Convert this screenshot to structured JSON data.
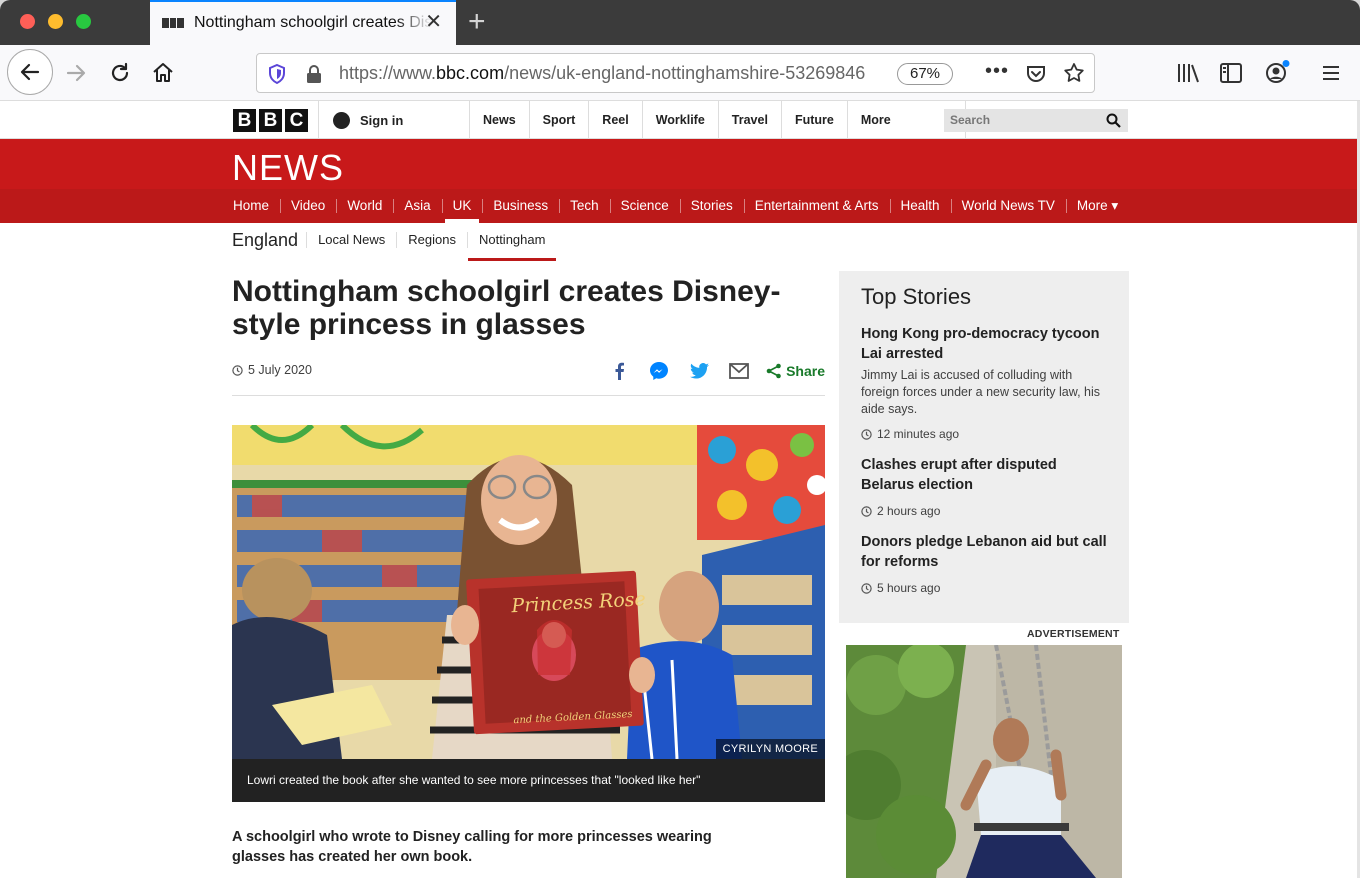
{
  "browser": {
    "tab_title": "Nottingham schoolgirl creates Disney-style princess in glasses",
    "url_prefix": "https://www.",
    "url_host": "bbc.com",
    "url_path": "/news/uk-england-nottinghamshire-53269846",
    "zoom": "67%"
  },
  "bbc": {
    "logo_letters": [
      "B",
      "B",
      "C"
    ],
    "signin": "Sign in",
    "topnav": [
      "News",
      "Sport",
      "Reel",
      "Worklife",
      "Travel",
      "Future",
      "More"
    ],
    "search_placeholder": "Search",
    "news_logo": "NEWS",
    "subnav": [
      "Home",
      "Video",
      "World",
      "Asia",
      "UK",
      "Business",
      "Tech",
      "Science",
      "Stories",
      "Entertainment & Arts",
      "Health",
      "World News TV",
      "More ▾"
    ],
    "subnav_active": "UK",
    "section_title": "England",
    "section_links": [
      "Local News",
      "Regions",
      "Nottingham"
    ],
    "section_active": "Nottingham"
  },
  "article": {
    "headline": "Nottingham schoolgirl creates Disney-style princess in glasses",
    "date": "5 July 2020",
    "share_label": "Share",
    "photo_credit": "CYRILYN MOORE",
    "caption": "Lowri created the book after she wanted to see more princesses that \"looked like her\"",
    "lede": "A schoolgirl who wrote to Disney calling for more princesses wearing glasses has created her own book.",
    "book_title": "Princess Rose",
    "book_subtitle": "and the Golden Glasses"
  },
  "sidebar": {
    "title": "Top Stories",
    "stories": [
      {
        "headline": "Hong Kong pro-democracy tycoon Lai arrested",
        "summary": "Jimmy Lai is accused of colluding with foreign forces under a new security law, his aide says.",
        "time": "12 minutes ago"
      },
      {
        "headline": "Clashes erupt after disputed Belarus election",
        "summary": "",
        "time": "2 hours ago"
      },
      {
        "headline": "Donors pledge Lebanon aid but call for reforms",
        "summary": "",
        "time": "5 hours ago"
      }
    ],
    "ad_label": "ADVERTISEMENT"
  },
  "colors": {
    "bbc_red": "#bb1919",
    "share_green": "#197a2a",
    "tab_accent": "#0a84ff"
  }
}
